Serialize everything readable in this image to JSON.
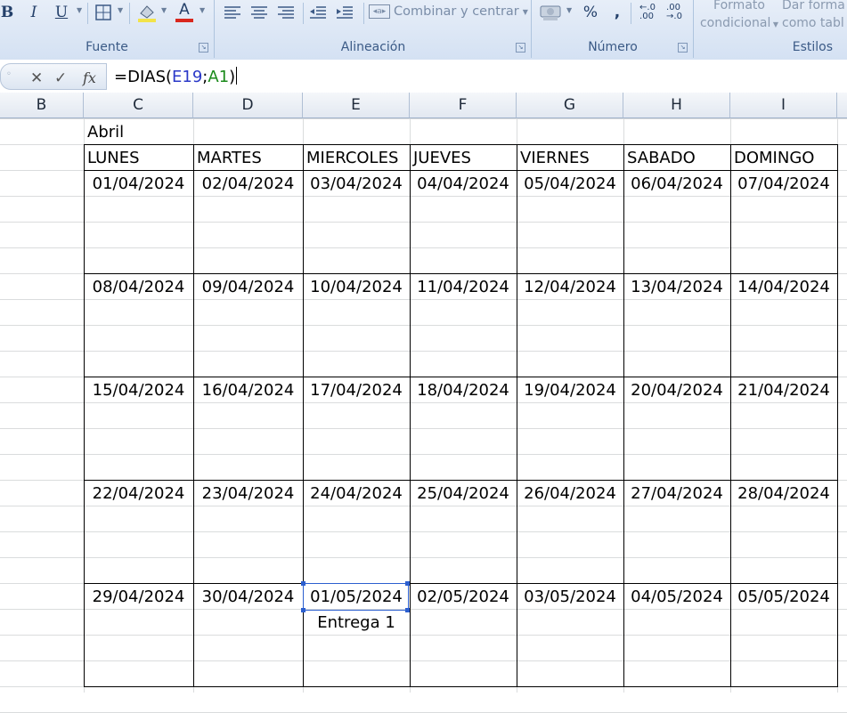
{
  "ribbon": {
    "groups": [
      {
        "label": "Fuente"
      },
      {
        "label": "Alineación"
      },
      {
        "label": "Número"
      },
      {
        "label": "Estilos"
      }
    ],
    "font_buttons": {
      "bold": "B",
      "italic": "I",
      "underline": "U",
      "font_color": "A"
    },
    "merge_label": "Combinar y centrar",
    "percent_label": "%",
    "comma_label": ",",
    "styles": {
      "conditional_line1": "Formato",
      "conditional_line2": "condicional",
      "table_line1": "Dar forma",
      "table_line2": "como tabl"
    }
  },
  "formula_bar": {
    "cancel": "✕",
    "enter": "✓",
    "fx": "fx",
    "formula_prefix": "=DIAS(",
    "ref1": "E19",
    "separator": ";",
    "ref2": "A1",
    "formula_suffix": ")"
  },
  "columns": [
    "B",
    "C",
    "D",
    "E",
    "F",
    "G",
    "H",
    "I"
  ],
  "calendar": {
    "month": "Abril",
    "weekdays": [
      "LUNES",
      "MARTES",
      "MIERCOLES",
      "JUEVES",
      "VIERNES",
      "SABADO",
      "DOMINGO"
    ],
    "weeks": [
      [
        "01/04/2024",
        "02/04/2024",
        "03/04/2024",
        "04/04/2024",
        "05/04/2024",
        "06/04/2024",
        "07/04/2024"
      ],
      [
        "08/04/2024",
        "09/04/2024",
        "10/04/2024",
        "11/04/2024",
        "12/04/2024",
        "13/04/2024",
        "14/04/2024"
      ],
      [
        "15/04/2024",
        "16/04/2024",
        "17/04/2024",
        "18/04/2024",
        "19/04/2024",
        "20/04/2024",
        "21/04/2024"
      ],
      [
        "22/04/2024",
        "23/04/2024",
        "24/04/2024",
        "25/04/2024",
        "26/04/2024",
        "27/04/2024",
        "28/04/2024"
      ],
      [
        "29/04/2024",
        "30/04/2024",
        "01/05/2024",
        "02/05/2024",
        "03/05/2024",
        "04/05/2024",
        "05/05/2024"
      ]
    ],
    "note": "Entrega 1"
  },
  "colors": {
    "selection": "#2c5fcf",
    "formula_ref1": "#2a38c8",
    "formula_ref2": "#1a8a1a"
  }
}
